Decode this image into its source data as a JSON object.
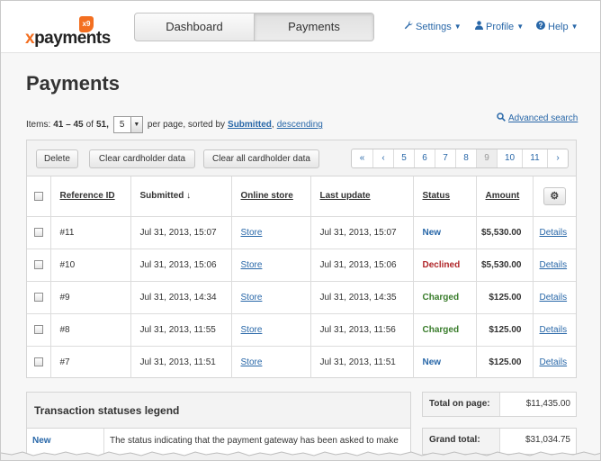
{
  "header": {
    "logo_text_x": "x",
    "logo_text_rest": "payments",
    "logo_badge": "x9",
    "tabs": [
      {
        "label": "Dashboard",
        "active": false
      },
      {
        "label": "Payments",
        "active": true
      }
    ],
    "nav": {
      "settings": "Settings",
      "profile": "Profile",
      "help": "Help"
    }
  },
  "page": {
    "title": "Payments"
  },
  "items_line": {
    "prefix": "Items:",
    "range": "41 – 45",
    "of": "of",
    "total": "51,",
    "per_page_value": "5",
    "mid_text": "per page, sorted by",
    "sort_field": "Submitted",
    "comma": ",",
    "sort_order": "descending"
  },
  "advanced_search": "Advanced search",
  "toolbar": {
    "delete": "Delete",
    "clear_cardholder": "Clear cardholder data",
    "clear_all_cardholder": "Clear all cardholder data"
  },
  "pager": [
    "«",
    "‹",
    "5",
    "6",
    "7",
    "8",
    "9",
    "10",
    "11",
    "›"
  ],
  "pager_current": "9",
  "table": {
    "columns": {
      "reference_id": "Reference ID",
      "submitted": "Submitted ↓",
      "online_store": "Online store",
      "last_update": "Last update",
      "status": "Status",
      "amount": "Amount"
    },
    "rows": [
      {
        "ref": "#11",
        "submitted": "Jul 31, 2013, 15:07",
        "store": "Store",
        "last_update": "Jul 31, 2013, 15:07",
        "status": "New",
        "amount": "$5,530.00",
        "details": "Details"
      },
      {
        "ref": "#10",
        "submitted": "Jul 31, 2013, 15:06",
        "store": "Store",
        "last_update": "Jul 31, 2013, 15:06",
        "status": "Declined",
        "amount": "$5,530.00",
        "details": "Details"
      },
      {
        "ref": "#9",
        "submitted": "Jul 31, 2013, 14:34",
        "store": "Store",
        "last_update": "Jul 31, 2013, 14:35",
        "status": "Charged",
        "amount": "$125.00",
        "details": "Details"
      },
      {
        "ref": "#8",
        "submitted": "Jul 31, 2013, 11:55",
        "store": "Store",
        "last_update": "Jul 31, 2013, 11:56",
        "status": "Charged",
        "amount": "$125.00",
        "details": "Details"
      },
      {
        "ref": "#7",
        "submitted": "Jul 31, 2013, 11:51",
        "store": "Store",
        "last_update": "Jul 31, 2013, 11:51",
        "status": "New",
        "amount": "$125.00",
        "details": "Details"
      }
    ]
  },
  "status_colors": {
    "New": "#2867a8",
    "Declined": "#b0272a",
    "Charged": "#3a7d2c"
  },
  "legend": {
    "title": "Transaction statuses legend",
    "first_status": "New",
    "first_desc": "The status indicating that the payment gateway has been asked to make"
  },
  "totals": {
    "page_label": "Total on page:",
    "page_value": "$11,435.00",
    "grand_label": "Grand total:",
    "grand_value": "$31,034.75"
  },
  "colors": {
    "brand_orange": "#f36f21",
    "link_blue": "#2867a8"
  }
}
